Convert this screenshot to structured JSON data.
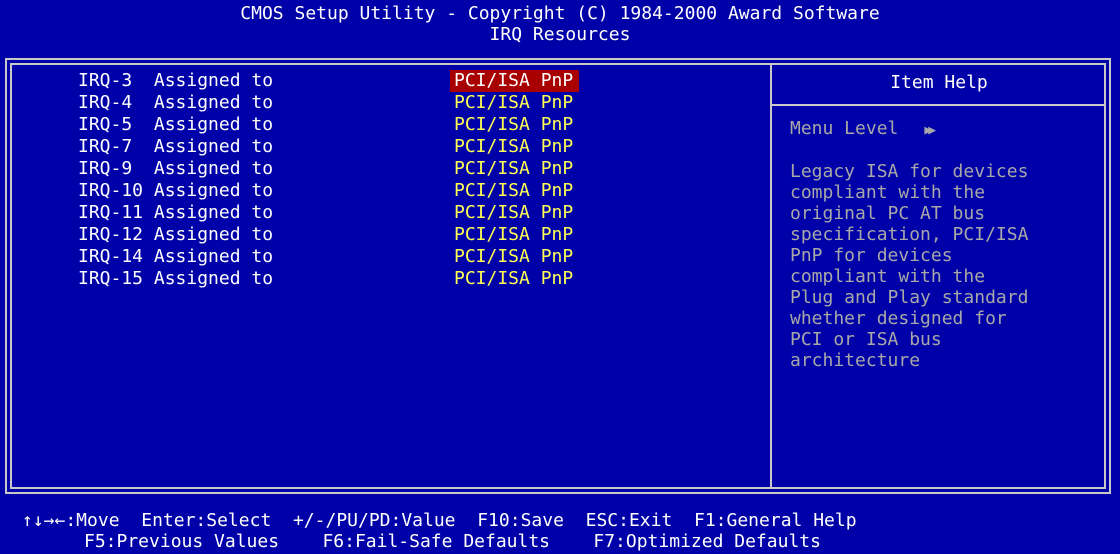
{
  "header": {
    "title": "CMOS Setup Utility - Copyright (C) 1984-2000 Award Software",
    "subtitle": "IRQ Resources"
  },
  "irq_rows": [
    {
      "label": "IRQ-3  Assigned to",
      "value": "PCI/ISA PnP"
    },
    {
      "label": "IRQ-4  Assigned to",
      "value": "PCI/ISA PnP"
    },
    {
      "label": "IRQ-5  Assigned to",
      "value": "PCI/ISA PnP"
    },
    {
      "label": "IRQ-7  Assigned to",
      "value": "PCI/ISA PnP"
    },
    {
      "label": "IRQ-9  Assigned to",
      "value": "PCI/ISA PnP"
    },
    {
      "label": "IRQ-10 Assigned to",
      "value": "PCI/ISA PnP"
    },
    {
      "label": "IRQ-11 Assigned to",
      "value": "PCI/ISA PnP"
    },
    {
      "label": "IRQ-12 Assigned to",
      "value": "PCI/ISA PnP"
    },
    {
      "label": "IRQ-14 Assigned to",
      "value": "PCI/ISA PnP"
    },
    {
      "label": "IRQ-15 Assigned to",
      "value": "PCI/ISA PnP"
    }
  ],
  "selected_row": 0,
  "help": {
    "title": "Item Help",
    "menu_level_label": "Menu Level",
    "menu_level_icon": "double-right-arrow-icon",
    "lines": [
      "Legacy ISA for devices",
      "compliant with the",
      "original PC AT bus",
      "specification, PCI/ISA",
      "PnP for devices",
      "compliant with the",
      "Plug and Play standard",
      "whether designed for",
      "PCI or ISA bus",
      "architecture"
    ]
  },
  "footer": {
    "move": "↑↓→←:Move",
    "enter": "Enter:Select",
    "value": "+/-/PU/PD:Value",
    "save": "F10:Save",
    "exit": "ESC:Exit",
    "general_help": "F1:General Help",
    "previous": "F5:Previous Values",
    "failsafe": "F6:Fail-Safe Defaults",
    "optimized": "F7:Optimized Defaults"
  },
  "colors": {
    "background": "#0000a8",
    "value_text": "#ffff54",
    "selected_bg": "#a80000",
    "help_text": "#a8a8a8"
  }
}
